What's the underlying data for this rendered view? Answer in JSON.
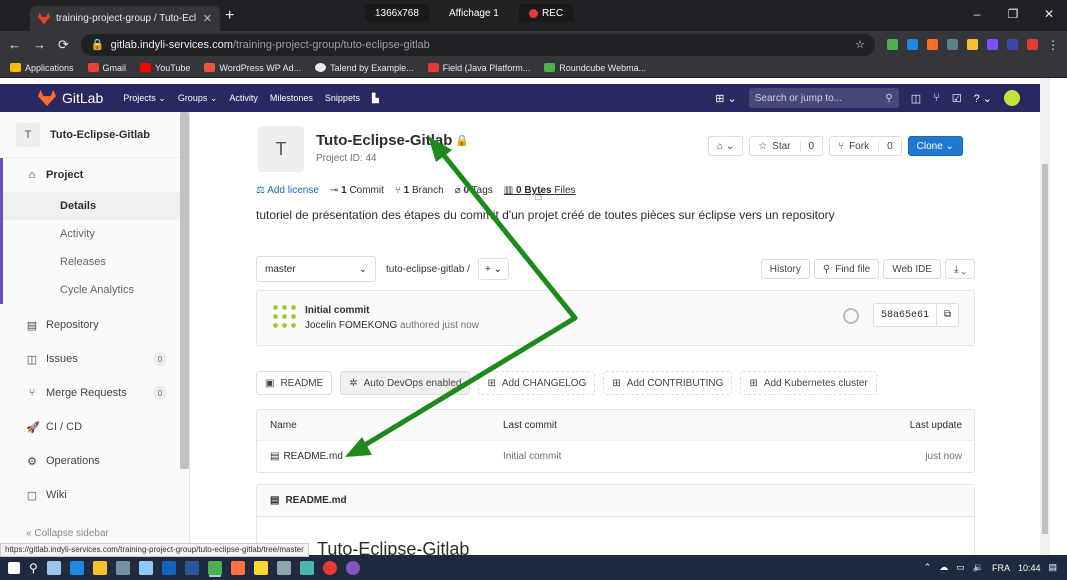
{
  "browser": {
    "tab_title": "training-project-group / Tuto-Ecl",
    "tab_close": "✕",
    "new_tab": "+",
    "url_host": "gitlab.indyli-services.com",
    "url_path": "/training-project-group/tuto-eclipse-gitlab",
    "recorder": {
      "resolution": "1366x768",
      "display": "Affichage 1",
      "rec": "REC"
    },
    "window_controls": [
      "–",
      "❐",
      "✕"
    ],
    "bookmarks": [
      {
        "label": "Applications",
        "color": "#fbbc04"
      },
      {
        "label": "Gmail",
        "color": "#ea4335"
      },
      {
        "label": "YouTube",
        "color": "#ff0000"
      },
      {
        "label": "WordPress WP Ad...",
        "color": "#e8553e"
      },
      {
        "label": "Talend by Example...",
        "color": "#e8eaed"
      },
      {
        "label": "Field (Java Platform...",
        "color": "#e53935"
      },
      {
        "label": "Roundcube Webma...",
        "color": "#4caf50"
      }
    ],
    "status_url": "https://gitlab.indyli-services.com/training-project-group/tuto-eclipse-gitlab/tree/master"
  },
  "gitlab_header": {
    "brand": "GitLab",
    "nav": [
      "Projects ⌄",
      "Groups ⌄",
      "Activity",
      "Milestones",
      "Snippets"
    ],
    "search_placeholder": "Search or jump to..."
  },
  "sidebar": {
    "project_initial": "T",
    "project_name": "Tuto-Eclipse-Gitlab",
    "project_label": "Project",
    "sub_items": [
      "Details",
      "Activity",
      "Releases",
      "Cycle Analytics"
    ],
    "items": [
      {
        "label": "Repository",
        "icon": "▤"
      },
      {
        "label": "Issues",
        "icon": "◫",
        "count": "0"
      },
      {
        "label": "Merge Requests",
        "icon": "⑂",
        "count": "0"
      },
      {
        "label": "CI / CD",
        "icon": "🚀"
      },
      {
        "label": "Operations",
        "icon": "⚙"
      },
      {
        "label": "Wiki",
        "icon": "▢"
      }
    ],
    "collapse": "Collapse sidebar"
  },
  "project": {
    "initial": "T",
    "title": "Tuto-Eclipse-Gitlab",
    "id_text": "Project ID: 44",
    "notify": "⌂ ⌄",
    "star": "Star",
    "star_count": "0",
    "fork": "Fork",
    "fork_count": "0",
    "clone": "Clone ⌄",
    "stats": {
      "add_license": "Add license",
      "commits_num": "1",
      "commits_label": "Commit",
      "branches_num": "1",
      "branches_label": "Branch",
      "tags_num": "0",
      "tags_label": "Tags",
      "files_size": "0 Bytes",
      "files_label": "Files"
    },
    "description": "tutoriel de présentation des étapes du commit d'un projet créé de toutes pièces sur éclipse vers un repository"
  },
  "branchbar": {
    "branch": "master",
    "crumb": "tuto-eclipse-gitlab  /",
    "add": "+  ⌄",
    "history": "History",
    "find_file": "Find file",
    "web_ide": "Web IDE",
    "download": "⤓ ⌄"
  },
  "commit": {
    "message": "Initial commit",
    "author": "Jocelin FOMEKONG",
    "authored": "authored just now",
    "sha": "58a65e61"
  },
  "quick_buttons": [
    "README",
    "Auto DevOps enabled",
    "Add CHANGELOG",
    "Add CONTRIBUTING",
    "Add Kubernetes cluster"
  ],
  "file_table": {
    "headers": [
      "Name",
      "Last commit",
      "Last update"
    ],
    "rows": [
      {
        "name": "README.md",
        "commit": "Initial commit",
        "update": "just now"
      }
    ]
  },
  "readme": {
    "file": "README.md",
    "heading": "Tuto-Eclipse-Gitlab"
  },
  "taskbar": {
    "lang": "FRA",
    "time": "10:44"
  },
  "colors": {
    "gitlab_nav": "#292961",
    "accent_purple": "#6b4fbb",
    "clone_blue": "#1f78d1",
    "arrow_green": "#1e8a1e"
  }
}
